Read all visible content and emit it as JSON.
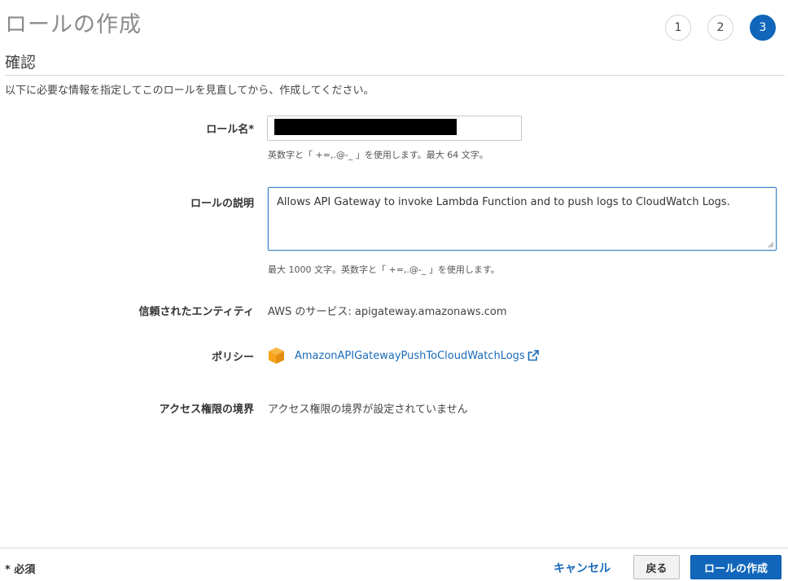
{
  "header": {
    "title": "ロールの作成",
    "steps": [
      "1",
      "2",
      "3"
    ],
    "active_step": "3"
  },
  "section": {
    "title": "確認",
    "intro": "以下に必要な情報を指定してこのロールを見直してから、作成してください。"
  },
  "form": {
    "role_name": {
      "label": "ロール名*",
      "value": "",
      "hint": "英数字と「 +=,.@-_ 」を使用します。最大 64 文字。"
    },
    "role_description": {
      "label": "ロールの説明",
      "value": "Allows API Gateway to invoke Lambda Function and to push logs to CloudWatch Logs.",
      "hint": "最大 1000 文字。英数字と「 +=,.@-_ 」を使用します。"
    },
    "trusted_entity": {
      "label": "信頼されたエンティティ",
      "value": "AWS のサービス: apigateway.amazonaws.com"
    },
    "policy": {
      "label": "ポリシー",
      "link": "AmazonAPIGatewayPushToCloudWatchLogs",
      "icon": "policy-cube-icon"
    },
    "permissions_boundary": {
      "label": "アクセス権限の境界",
      "value": "アクセス権限の境界が設定されていません"
    }
  },
  "footer": {
    "required_note": "* 必須",
    "cancel_label": "キャンセル",
    "back_label": "戻る",
    "create_label": "ロールの作成"
  },
  "colors": {
    "primary": "#1166bb",
    "link": "#1a6bb8",
    "policy_icon": "#f7a21b"
  }
}
